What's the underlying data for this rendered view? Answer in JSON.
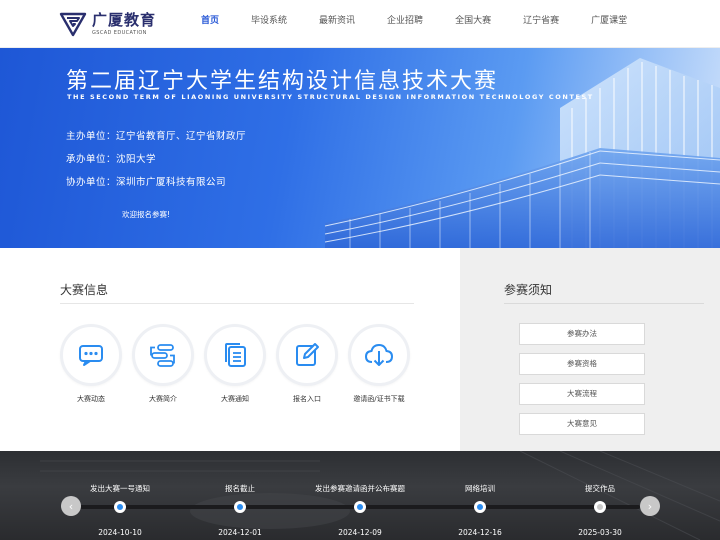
{
  "header": {
    "logo_cn": "广厦教育",
    "logo_en": "GSCAD EDUCATION",
    "nav": [
      {
        "label": "首页",
        "active": true
      },
      {
        "label": "毕设系统",
        "active": false
      },
      {
        "label": "最新资讯",
        "active": false
      },
      {
        "label": "企业招聘",
        "active": false
      },
      {
        "label": "全国大赛",
        "active": false
      },
      {
        "label": "辽宁省赛",
        "active": false
      },
      {
        "label": "广厦课堂",
        "active": false
      }
    ]
  },
  "banner": {
    "title": "第二届辽宁大学生结构设计信息技术大赛",
    "subtitle": "THE SECOND TERM OF LIAONING UNIVERSITY STRUCTURAL DESIGN INFORMATION TECHNOLOGY CONTEST",
    "organizer": "主办单位：辽宁省教育厅、辽宁省财政厅",
    "host": "承办单位：沈阳大学",
    "co_organizer": "协办单位：深圳市广厦科技有限公司",
    "welcome": "欢迎报名参赛!"
  },
  "info": {
    "title": "大赛信息",
    "items": [
      {
        "label": "大赛动态",
        "icon": "chat-bubble-icon"
      },
      {
        "label": "大赛简介",
        "icon": "flow-icon"
      },
      {
        "label": "大赛通知",
        "icon": "documents-icon"
      },
      {
        "label": "报名入口",
        "icon": "edit-icon"
      },
      {
        "label": "邀请函/证书下载",
        "icon": "cloud-download-icon"
      }
    ]
  },
  "notice": {
    "title": "参赛须知",
    "buttons": [
      "参赛办法",
      "参赛资格",
      "大赛流程",
      "大赛意见"
    ]
  },
  "timeline": {
    "items": [
      {
        "title": "发出大赛一号通知",
        "date": "2024-10-10",
        "done": true
      },
      {
        "title": "报名截止",
        "date": "2024-12-01",
        "done": true
      },
      {
        "title": "发出参赛邀请函并公布赛题",
        "date": "2024-12-09",
        "done": true
      },
      {
        "title": "网络培训",
        "date": "2024-12-16",
        "done": true
      },
      {
        "title": "提交作品",
        "date": "2025-03-30",
        "done": false
      }
    ],
    "prev_icon": "chevron-left-icon",
    "next_icon": "chevron-right-icon"
  },
  "colors": {
    "accent": "#2a5ad7",
    "banner_blue": "#2f6fe6",
    "timeline_dot": "#2a8cf0",
    "logo_navy": "#2a2f6e"
  }
}
